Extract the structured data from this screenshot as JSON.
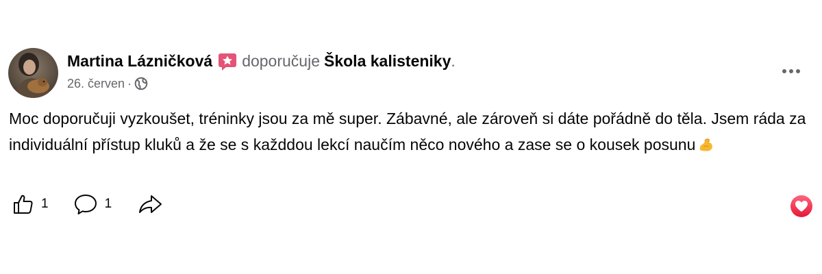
{
  "post": {
    "author": "Martina Lázničková",
    "verb": "doporučuje",
    "page_name": "Škola kalisteniky",
    "page_name_suffix": ".",
    "date": "26. červen",
    "separator": "·",
    "privacy_icon": "globe-icon",
    "more_icon": "more-options-icon",
    "body": "Moc doporučuji vyzkoušet, tréninky jsou za mě super. Zábavné, ale zároveň si dáte pořádně do těla. Jsem ráda za individuální přístup kluků a že se s každdou lekcí naučím něco nového a zase se o kousek posunu",
    "body_emoji": "flexed-biceps-emoji",
    "likes_count": "1",
    "comments_count": "1",
    "reaction_icon": "love-reaction-icon"
  },
  "colors": {
    "text_primary": "#050505",
    "text_secondary": "#65676b",
    "recommend_badge": "#e35477",
    "love_red": "#f02849"
  }
}
